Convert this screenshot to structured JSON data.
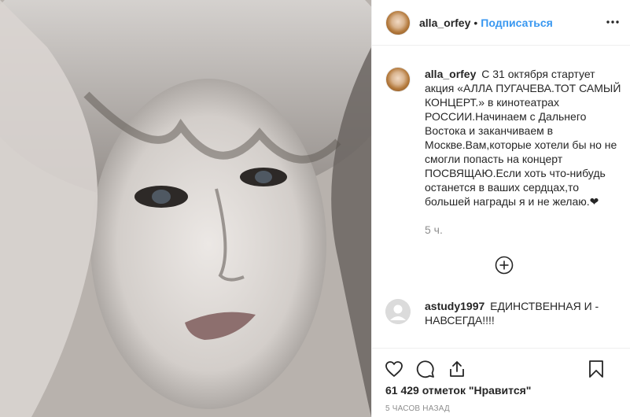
{
  "post": {
    "username": "alla_orfey",
    "separator": "•",
    "follow_label": "Подписаться",
    "caption_text": "С 31 октября стартует акция «АЛЛА ПУГАЧЕВА.ТОТ САМЫЙ КОНЦЕРТ.» в кинотеатрах РОССИИ.Начинаем с Дальнего Востока и заканчиваем в Москве.Вам,которые хотели бы но не смогли попасть на концерт ПОСВЯЩАЮ.Если хоть что-нибудь останется в ваших сердцах,то большей награды я и не желаю.❤",
    "time_ago": "5 ч.",
    "likes_text": "61 429 отметок \"Нравится\"",
    "posted_ago": "5 часов назад"
  },
  "comments": [
    {
      "username": "astudy1997",
      "text": "ЕДИНСТВЕННАЯ И - НАВСЕГДА!!!!"
    }
  ],
  "icons": {
    "more": "more-dots-icon",
    "load_more": "plus-circle-icon",
    "like": "heart-icon",
    "comment": "comment-bubble-icon",
    "share": "share-icon",
    "save": "bookmark-icon"
  },
  "colors": {
    "link_blue": "#3897f0",
    "text": "#262626",
    "muted": "#8e8e8e",
    "divider": "#efefef"
  }
}
